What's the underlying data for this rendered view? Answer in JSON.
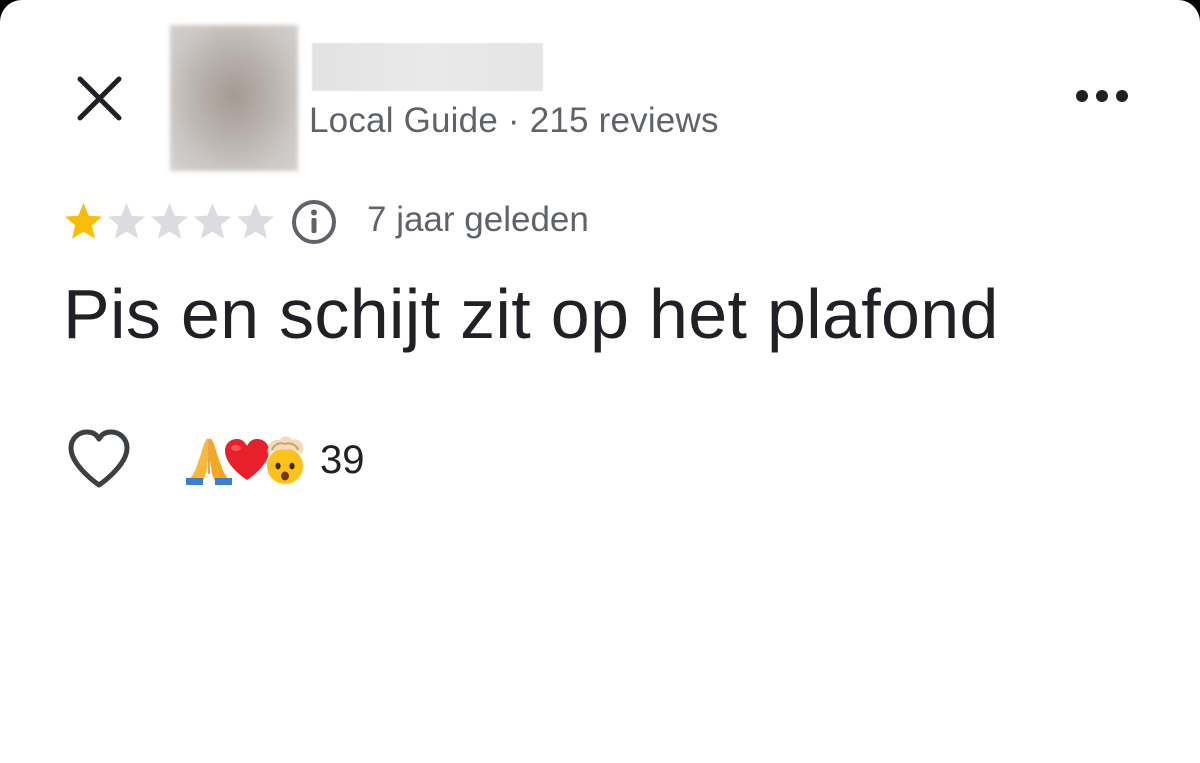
{
  "reviewer": {
    "name": "",
    "meta": "Local Guide · 215 reviews"
  },
  "review": {
    "rating": 1,
    "max_rating": 5,
    "time_ago": "7 jaar geleden",
    "text": "Pis en schijt zit op het plafond"
  },
  "reactions": {
    "emojis": [
      "folded-hands-emoji",
      "red-heart-emoji",
      "exploding-head-emoji"
    ],
    "count": "39"
  },
  "icons": {
    "close": "close-icon",
    "more": "more-horizontal-icon",
    "info": "info-icon",
    "like": "heart-outline-icon"
  },
  "colors": {
    "star_filled": "#fbbc04",
    "star_empty": "#dadce0",
    "text_primary": "#202124",
    "text_secondary": "#5f6368"
  }
}
